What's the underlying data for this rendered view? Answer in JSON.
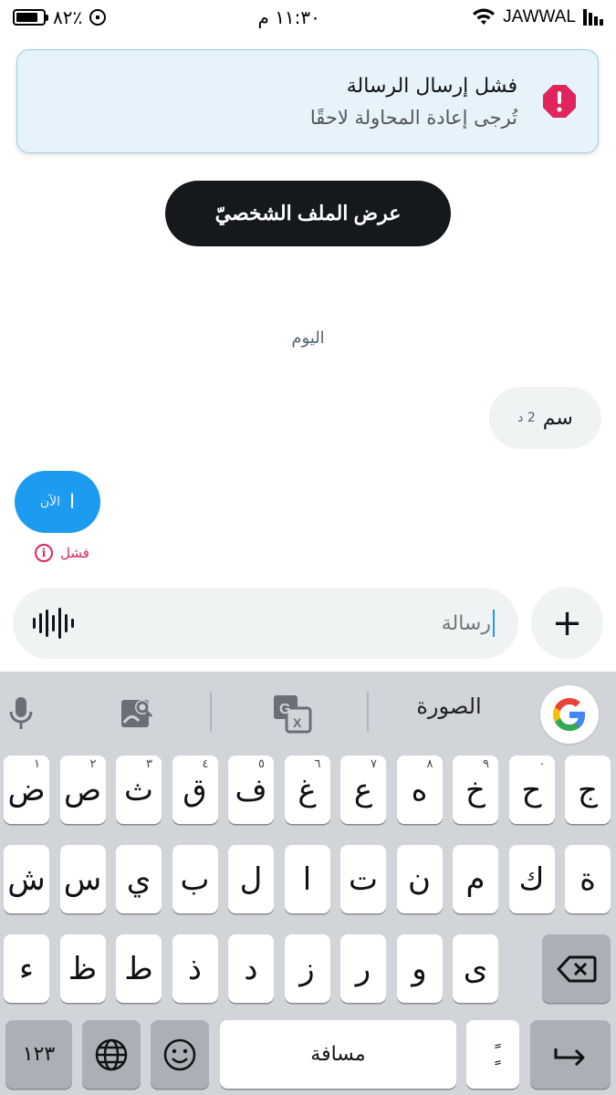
{
  "status_bar": {
    "battery": "٨٢٪",
    "time": "١١:٣٠ م",
    "carrier": "JAWWAL"
  },
  "notification": {
    "title": "فشل إرسال الرسالة",
    "subtitle": "تُرجى إعادة المحاولة لاحقًا"
  },
  "profile_button": "عرض الملف الشخصيّ",
  "chat": {
    "date_label": "اليوم",
    "incoming": {
      "text": "سم",
      "time": "2 د"
    },
    "outgoing": {
      "text": "ا",
      "time": "الآن"
    },
    "failed_label": "فشل"
  },
  "composer": {
    "placeholder": "رسالة",
    "add_label": "+"
  },
  "keyboard": {
    "suggestion": "الصورة",
    "google_logo": "G",
    "row1": [
      {
        "k": "ج",
        "h": ""
      },
      {
        "k": "ح",
        "h": "٠"
      },
      {
        "k": "خ",
        "h": "٩"
      },
      {
        "k": "ه",
        "h": "٨"
      },
      {
        "k": "ع",
        "h": "٧"
      },
      {
        "k": "غ",
        "h": "٦"
      },
      {
        "k": "ف",
        "h": "٥"
      },
      {
        "k": "ق",
        "h": "٤"
      },
      {
        "k": "ث",
        "h": "٣"
      },
      {
        "k": "ص",
        "h": "٢"
      },
      {
        "k": "ض",
        "h": "١"
      }
    ],
    "row2": [
      "ة",
      "ك",
      "م",
      "ن",
      "ت",
      "ا",
      "ل",
      "ب",
      "ي",
      "س",
      "ش"
    ],
    "row3": [
      "ى",
      "و",
      "ر",
      "ز",
      "د",
      "ذ",
      "ط",
      "ظ",
      "ء"
    ],
    "numbers_key": "١٢٣",
    "space_key": "مسافة",
    "punct_key": "ًٍ",
    "return_key": "↵"
  },
  "colors": {
    "accent": "#1d9bf0",
    "error": "#e0245e",
    "notification_bg": "#e6f3fb"
  }
}
